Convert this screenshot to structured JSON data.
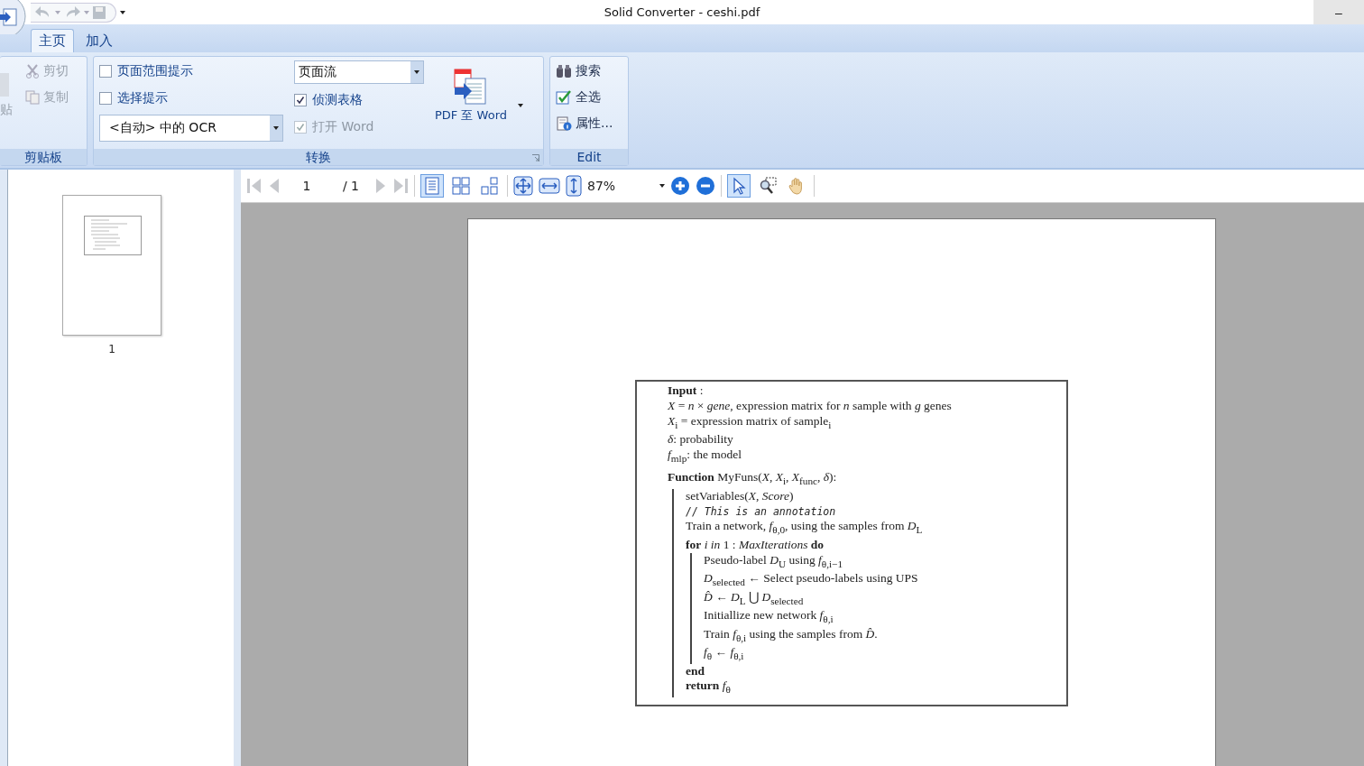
{
  "window": {
    "title": "Solid Converter - ceshi.pdf",
    "minimize": "–"
  },
  "tabs": [
    {
      "label": "主页",
      "selected": true
    },
    {
      "label": "加入",
      "selected": false
    }
  ],
  "ribbon": {
    "clipboard": {
      "paste_label": "贴",
      "cut": "剪切",
      "copy": "复制",
      "group_label": "剪贴板"
    },
    "convert": {
      "checkboxes": [
        {
          "label": "页面范围提示",
          "checked": false,
          "disabled": false
        },
        {
          "label": "选择提示",
          "checked": false,
          "disabled": false
        }
      ],
      "ocr_select": "<自动> 中的 OCR",
      "mode_select": "页面流",
      "options": [
        {
          "label": "侦测表格",
          "checked": true,
          "disabled": false
        },
        {
          "label": "打开 Word",
          "checked": true,
          "disabled": true
        }
      ],
      "convert_button": "PDF 至 Word",
      "group_label": "转换"
    },
    "edit": {
      "items": [
        {
          "label": "搜索"
        },
        {
          "label": "全选"
        },
        {
          "label": "属性..."
        }
      ],
      "group_label": "Edit"
    }
  },
  "toolbar": {
    "page": "1",
    "page_total": "/ 1",
    "view_modes": [
      {
        "selected": true
      },
      {
        "selected": false
      },
      {
        "selected": false
      }
    ],
    "zoom": "87%",
    "tools": [
      {
        "selected": true
      },
      {
        "selected": false
      },
      {
        "selected": false
      }
    ]
  },
  "thumbnails": [
    {
      "label": "1"
    }
  ],
  "document": {
    "input_lines": [
      "**Input** :",
      "*X* = *n* × *gene*, expression matrix for *n* sample with *g* genes",
      "*X*$_{i}$ = expression matrix of sample$_{i}$",
      "*δ*: probability",
      "*f*$_{mlp}$: the model"
    ],
    "function": {
      "text": "**Function** MyFuns(*X*, *X*$_{i}$, *X*$_{func}$, *δ*):",
      "children": [
        {
          "kind": "text",
          "text": "setVariables(*X*, *Score*)"
        },
        {
          "kind": "comment",
          "text": "// This is an annotation"
        },
        {
          "kind": "text",
          "text": "Train a network, *f*$_{θ,0}$, using the samples from *D*$_{L}$"
        },
        {
          "kind": "text",
          "text": "**for** *i in* 1 : *MaxIterations* **do**",
          "children": [
            {
              "text": "Pseudo-label *D*$_{U}$ using *f*$_{θ,i−1}$"
            },
            {
              "text": "*D*$_{selected}$ ← Select pseudo-labels using UPS"
            },
            {
              "text": "*D̂* ← *D*$_{L}$ ⋃ *D*$_{selected}$"
            },
            {
              "text": "Initiallize new network *f*$_{θ,i}$"
            },
            {
              "text": "Train *f*$_{θ,i}$ using the samples from *D̂*."
            },
            {
              "text": "*f*$_{θ}$ ← *f*$_{θ,i}$"
            }
          ]
        },
        {
          "kind": "text",
          "text": "**end**"
        },
        {
          "kind": "text",
          "text": "**return** *f*$_{θ}$"
        }
      ]
    }
  }
}
